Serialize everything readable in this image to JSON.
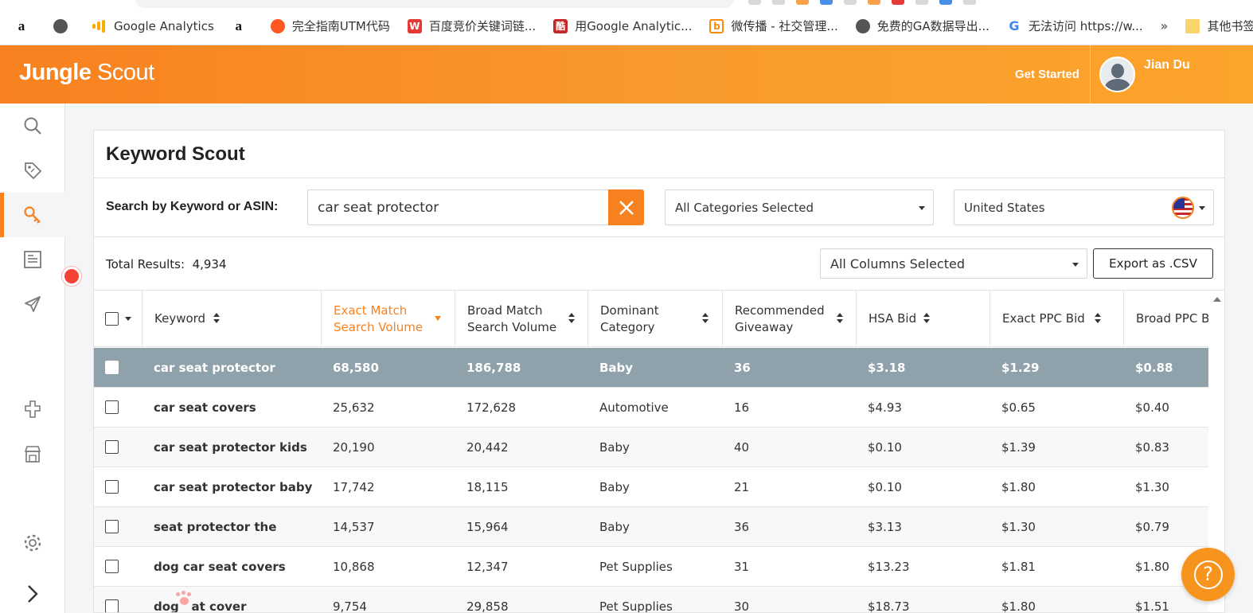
{
  "browser": {
    "bookmarks": [
      {
        "icon": "amazon-icon",
        "label": ""
      },
      {
        "icon": "globe-icon",
        "label": ""
      },
      {
        "icon": "google-analytics-icon",
        "label": "Google Analytics"
      },
      {
        "icon": "amazon-icon",
        "label": ""
      },
      {
        "icon": "orange-circle-icon",
        "label": "完全指南UTM代码"
      },
      {
        "icon": "w-letter-icon",
        "label": "百度竞价关键词链..."
      },
      {
        "icon": "ku-icon",
        "label": "用Google Analytic..."
      },
      {
        "icon": "weibo-icon",
        "label": "微传播 - 社交管理..."
      },
      {
        "icon": "globe-icon",
        "label": "免费的GA数据导出..."
      },
      {
        "icon": "google-g-icon",
        "label": "无法访问 https://w..."
      }
    ],
    "more_label": "»",
    "other_bookmarks_label": "其他书签"
  },
  "header": {
    "logo_bold": "Jungle",
    "logo_light": "Scout",
    "get_started": "Get Started",
    "user_name": "Jian Du",
    "accent": "#f7811f"
  },
  "sidebar": {
    "items": [
      {
        "name": "search-icon",
        "active": false
      },
      {
        "name": "tag-icon",
        "active": false
      },
      {
        "name": "key-icon",
        "active": true
      },
      {
        "name": "book-icon",
        "active": false
      },
      {
        "name": "rocket-icon",
        "active": false
      },
      {
        "name": "puzzle-icon",
        "active": false
      },
      {
        "name": "store-icon",
        "active": false
      },
      {
        "name": "gear-icon",
        "active": false
      },
      {
        "name": "chevron-right-icon",
        "active": false
      }
    ]
  },
  "panel": {
    "title": "Keyword Scout",
    "search_label": "Search by Keyword or ASIN:",
    "search_value": "car seat protector",
    "categories_select": "All Categories Selected",
    "country_select": "United States",
    "total_label": "Total Results:",
    "total_value": "4,934",
    "columns_select": "All Columns Selected",
    "export_label": "Export as .CSV"
  },
  "table": {
    "headers": [
      {
        "line1": "Keyword",
        "line2": ""
      },
      {
        "line1": "Exact Match",
        "line2": "Search Volume"
      },
      {
        "line1": "Broad Match",
        "line2": "Search Volume"
      },
      {
        "line1": "Dominant",
        "line2": "Category"
      },
      {
        "line1": "Recommended",
        "line2": "Giveaway"
      },
      {
        "line1": "HSA Bid",
        "line2": ""
      },
      {
        "line1": "Exact PPC Bid",
        "line2": ""
      },
      {
        "line1": "Broad PPC B",
        "line2": ""
      }
    ],
    "rows": [
      [
        "car seat protector",
        "68,580",
        "186,788",
        "Baby",
        "36",
        "$3.18",
        "$1.29",
        "$0.88"
      ],
      [
        "car seat covers",
        "25,632",
        "172,628",
        "Automotive",
        "16",
        "$4.93",
        "$0.65",
        "$0.40"
      ],
      [
        "car seat protector kids",
        "20,190",
        "20,442",
        "Baby",
        "40",
        "$0.10",
        "$1.39",
        "$0.83"
      ],
      [
        "car seat protector baby",
        "17,742",
        "18,115",
        "Baby",
        "21",
        "$0.10",
        "$1.80",
        "$1.30"
      ],
      [
        "seat protector the",
        "14,537",
        "15,964",
        "Baby",
        "36",
        "$3.13",
        "$1.30",
        "$0.79"
      ],
      [
        "dog car seat covers",
        "10,868",
        "12,347",
        "Pet Supplies",
        "31",
        "$13.23",
        "$1.81",
        "$1.80"
      ],
      [
        "dog   at cover",
        "9,754",
        "29,858",
        "Pet Supplies",
        "30",
        "$18.73",
        "$1.80",
        "$1.51"
      ]
    ]
  },
  "help_label": "?"
}
